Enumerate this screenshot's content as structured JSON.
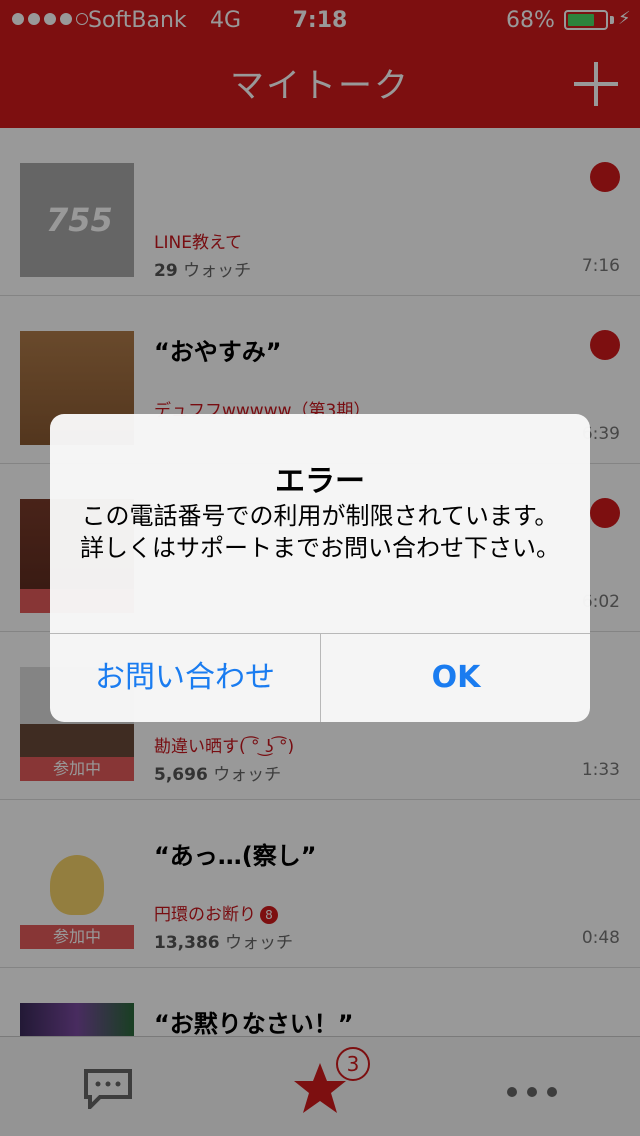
{
  "status": {
    "carrier": "SoftBank",
    "network": "4G",
    "time": "7:18",
    "battery": "68%",
    "battery_level": 0.68
  },
  "nav": {
    "title": "マイトーク"
  },
  "rows": [
    {
      "title": "",
      "group": "LINE教えて",
      "watch_count": "29",
      "watch_label": "ウォッチ",
      "time": "7:16"
    },
    {
      "title": "“おやすみ”",
      "group": "デュフフwwwww（第3期）",
      "watch_count": "",
      "watch_label": "",
      "time": "6:39"
    },
    {
      "title": "",
      "group": "",
      "watch_count": "",
      "watch_label": "",
      "time": "6:02"
    },
    {
      "title": "",
      "group": "勘違い晒す( ͡° ͜ʖ ͡°)",
      "watch_count": "5,696",
      "watch_label": "ウォッチ",
      "time": "1:33",
      "join_label": "参加中"
    },
    {
      "title": "“あっ…(察し”",
      "group": "円環のお断り",
      "group_badge": "8",
      "watch_count": "13,386",
      "watch_label": "ウォッチ",
      "time": "0:48",
      "join_label": "参加中"
    },
    {
      "title": "“お黙りなさい！”",
      "group": "",
      "watch_count": "",
      "watch_label": "",
      "time": ""
    }
  ],
  "thumb_text": "755",
  "tabbar": {
    "badge": "3"
  },
  "alert": {
    "title": "エラー",
    "message": "この電話番号での利用が制限されています。詳しくはサポートまでお問い合わせ下さい。",
    "button_left": "お問い合わせ",
    "button_right": "OK"
  },
  "colors": {
    "brand": "#d0191b",
    "link": "#1a7cf0"
  }
}
